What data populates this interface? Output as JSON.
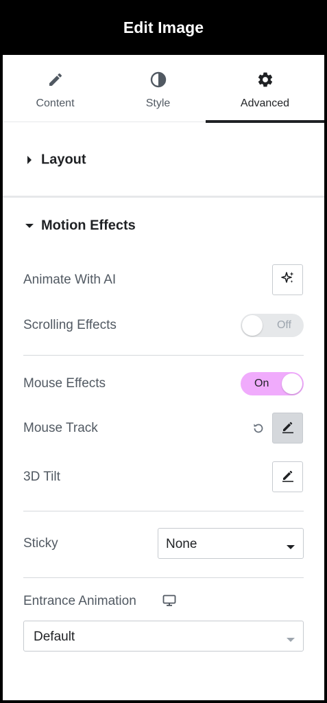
{
  "header": {
    "title": "Edit Image"
  },
  "tabs": [
    {
      "label": "Content",
      "icon": "pencil-icon"
    },
    {
      "label": "Style",
      "icon": "contrast-icon"
    },
    {
      "label": "Advanced",
      "icon": "gear-icon"
    }
  ],
  "sections": {
    "layout": {
      "title": "Layout"
    },
    "motion": {
      "title": "Motion Effects"
    }
  },
  "motion": {
    "animate_ai_label": "Animate With AI",
    "scrolling_label": "Scrolling Effects",
    "scrolling_state": "Off",
    "mouse_label": "Mouse Effects",
    "mouse_state": "On",
    "mouse_track_label": "Mouse Track",
    "tilt_label": "3D Tilt",
    "sticky_label": "Sticky",
    "sticky_value": "None",
    "entrance_label": "Entrance Animation",
    "entrance_value": "Default"
  },
  "colors": {
    "header_bg": "#000000",
    "toggle_on": "#f0abfc",
    "toggle_off": "#e6e8ea",
    "active_tab_underline": "#1f2124"
  }
}
